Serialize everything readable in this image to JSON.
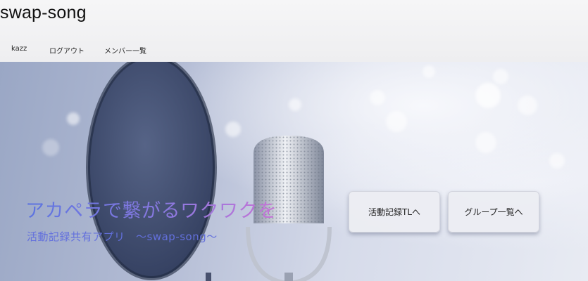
{
  "header": {
    "app_title": "swap-song",
    "nav": [
      "kazz",
      "ログアウト",
      "メンバー一覧"
    ]
  },
  "hero": {
    "tagline": "アカペラで繋がるワクワクを",
    "subtitle": "活動記録共有アプリ　〜swap-song〜",
    "buttons": [
      "活動記録TLへ",
      "グループ一覧へ"
    ]
  },
  "colors": {
    "tagline_gradient_start": "#5b74e0",
    "tagline_gradient_end": "#c773d6",
    "subtitle": "#6370dd"
  }
}
